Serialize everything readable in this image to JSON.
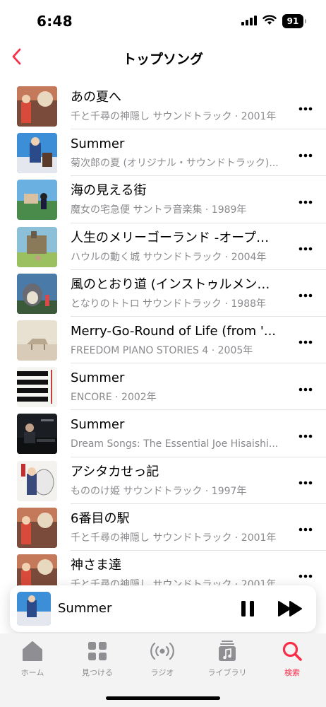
{
  "status_bar": {
    "time": "6:48",
    "battery": "91",
    "icons": [
      "cellular-signal-icon",
      "wifi-icon",
      "battery-icon"
    ]
  },
  "nav": {
    "title": "トップソング",
    "back_icon": "chevron-left-icon"
  },
  "songs": [
    {
      "title": "あの夏へ",
      "subtitle": "千と千尋の神隠し サウンドトラック · 2001年"
    },
    {
      "title": "Summer",
      "subtitle": "菊次郎の夏 (オリジナル・サウンドトラック)..."
    },
    {
      "title": "海の見える街",
      "subtitle": "魔女の宅急便 サントラ音楽集 · 1989年"
    },
    {
      "title": "人生のメリーゴーランド -オープ…",
      "subtitle": "ハウルの動く城 サウンドトラック · 2004年"
    },
    {
      "title": "風のとおり道 (インストゥルメン…",
      "subtitle": "となりのトトロ サウンドトラック · 1988年"
    },
    {
      "title": "Merry-Go-Round of Life (from '...",
      "subtitle": "FREEDOM PIANO STORIES 4 · 2005年"
    },
    {
      "title": "Summer",
      "subtitle": "ENCORE · 2002年"
    },
    {
      "title": "Summer",
      "subtitle": "Dream Songs: The Essential Joe Hisaishi..."
    },
    {
      "title": "アシタカせっ記",
      "subtitle": "もののけ姫 サウンドトラック · 1997年"
    },
    {
      "title": "6番目の駅",
      "subtitle": "千と千尋の神隠し サウンドトラック · 2001年"
    },
    {
      "title": "神さま達",
      "subtitle": "千と千尋の神隠し サウンドトラック · 2001年"
    }
  ],
  "now_playing": {
    "title": "Summer",
    "controls": [
      "pause-icon",
      "next-track-icon"
    ]
  },
  "tabs": [
    {
      "label": "ホーム",
      "icon": "home-icon",
      "active": false
    },
    {
      "label": "見つける",
      "icon": "grid-icon",
      "active": false
    },
    {
      "label": "ラジオ",
      "icon": "radio-icon",
      "active": false
    },
    {
      "label": "ライブラリ",
      "icon": "library-icon",
      "active": false
    },
    {
      "label": "検索",
      "icon": "search-icon",
      "active": true
    }
  ],
  "colors": {
    "accent": "#fa2d48",
    "secondary_text": "#8a8a8e",
    "tab_inactive": "#8e8e93",
    "tab_bar_bg": "#f3f3f3"
  }
}
